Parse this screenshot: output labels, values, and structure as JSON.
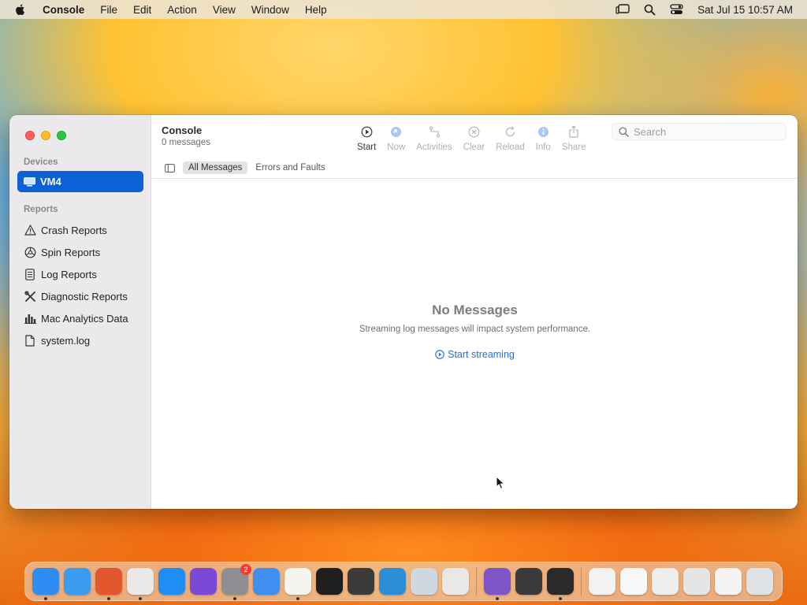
{
  "menubar": {
    "app_name": "Console",
    "items": [
      "File",
      "Edit",
      "Action",
      "View",
      "Window",
      "Help"
    ],
    "clock": "Sat Jul 15  10:57 AM"
  },
  "window": {
    "title": "Console",
    "subtitle": "0 messages",
    "toolbar": [
      {
        "label": "Start",
        "icon": "play-circle-icon",
        "enabled": true
      },
      {
        "label": "Now",
        "icon": "now-icon",
        "enabled": false
      },
      {
        "label": "Activities",
        "icon": "activities-icon",
        "enabled": false
      },
      {
        "label": "Clear",
        "icon": "clear-icon",
        "enabled": false
      },
      {
        "label": "Reload",
        "icon": "reload-icon",
        "enabled": false
      },
      {
        "label": "Info",
        "icon": "info-icon",
        "enabled": false
      },
      {
        "label": "Share",
        "icon": "share-icon",
        "enabled": false
      }
    ],
    "search_placeholder": "Search",
    "scopes": [
      "All Messages",
      "Errors and Faults"
    ],
    "selected_scope": "All Messages"
  },
  "sidebar": {
    "devices_title": "Devices",
    "device": "VM4",
    "reports_title": "Reports",
    "reports": [
      {
        "label": "Crash Reports",
        "icon": "warning-triangle-icon"
      },
      {
        "label": "Spin Reports",
        "icon": "spin-icon"
      },
      {
        "label": "Log Reports",
        "icon": "document-icon"
      },
      {
        "label": "Diagnostic Reports",
        "icon": "tools-icon"
      },
      {
        "label": "Mac Analytics Data",
        "icon": "bar-chart-icon"
      },
      {
        "label": "system.log",
        "icon": "file-icon"
      }
    ]
  },
  "empty_state": {
    "title": "No Messages",
    "description": "Streaming log messages will impact system performance.",
    "action": "Start streaming"
  },
  "dock": {
    "apps": [
      {
        "name": "finder",
        "color": "#2f8cf3",
        "running": true
      },
      {
        "name": "safari",
        "color": "#3b9bef",
        "running": false
      },
      {
        "name": "firefox",
        "color": "#e4572e",
        "running": true
      },
      {
        "name": "chrome",
        "color": "#e9e9e9",
        "running": true
      },
      {
        "name": "app-store",
        "color": "#1e8ef6",
        "running": false
      },
      {
        "name": "podcasts",
        "color": "#7a4ad6",
        "running": false
      },
      {
        "name": "system-settings",
        "color": "#8e8e93",
        "running": true,
        "badge": "2"
      },
      {
        "name": "weather",
        "color": "#3f8ff0",
        "running": false
      },
      {
        "name": "textedit",
        "color": "#f5f5f0",
        "running": true
      },
      {
        "name": "terminal",
        "color": "#1e1e1e",
        "running": false
      },
      {
        "name": "instruments",
        "color": "#3b3b3b",
        "running": false
      },
      {
        "name": "vscode",
        "color": "#2b8fd8",
        "running": false
      },
      {
        "name": "preview",
        "color": "#cfd7e0",
        "running": false
      },
      {
        "name": "launchpad",
        "color": "#e8e8e8",
        "running": false
      },
      {
        "name": "visual-studio",
        "color": "#7d55c7",
        "running": true
      },
      {
        "name": "calculator",
        "color": "#3a3a3a",
        "running": false
      },
      {
        "name": "console",
        "color": "#2a2a2a",
        "running": true
      },
      {
        "name": "minimized-window-1",
        "color": "#f2f2f2",
        "running": false
      },
      {
        "name": "minimized-window-2",
        "color": "#f7f7f7",
        "running": false
      },
      {
        "name": "minimized-window-3",
        "color": "#eeeeee",
        "running": false
      },
      {
        "name": "minimized-window-4",
        "color": "#e5e5e5",
        "running": false
      },
      {
        "name": "minimized-window-5",
        "color": "#f4f4f4",
        "running": false
      },
      {
        "name": "trash",
        "color": "#dfe3e6",
        "running": false
      }
    ]
  }
}
